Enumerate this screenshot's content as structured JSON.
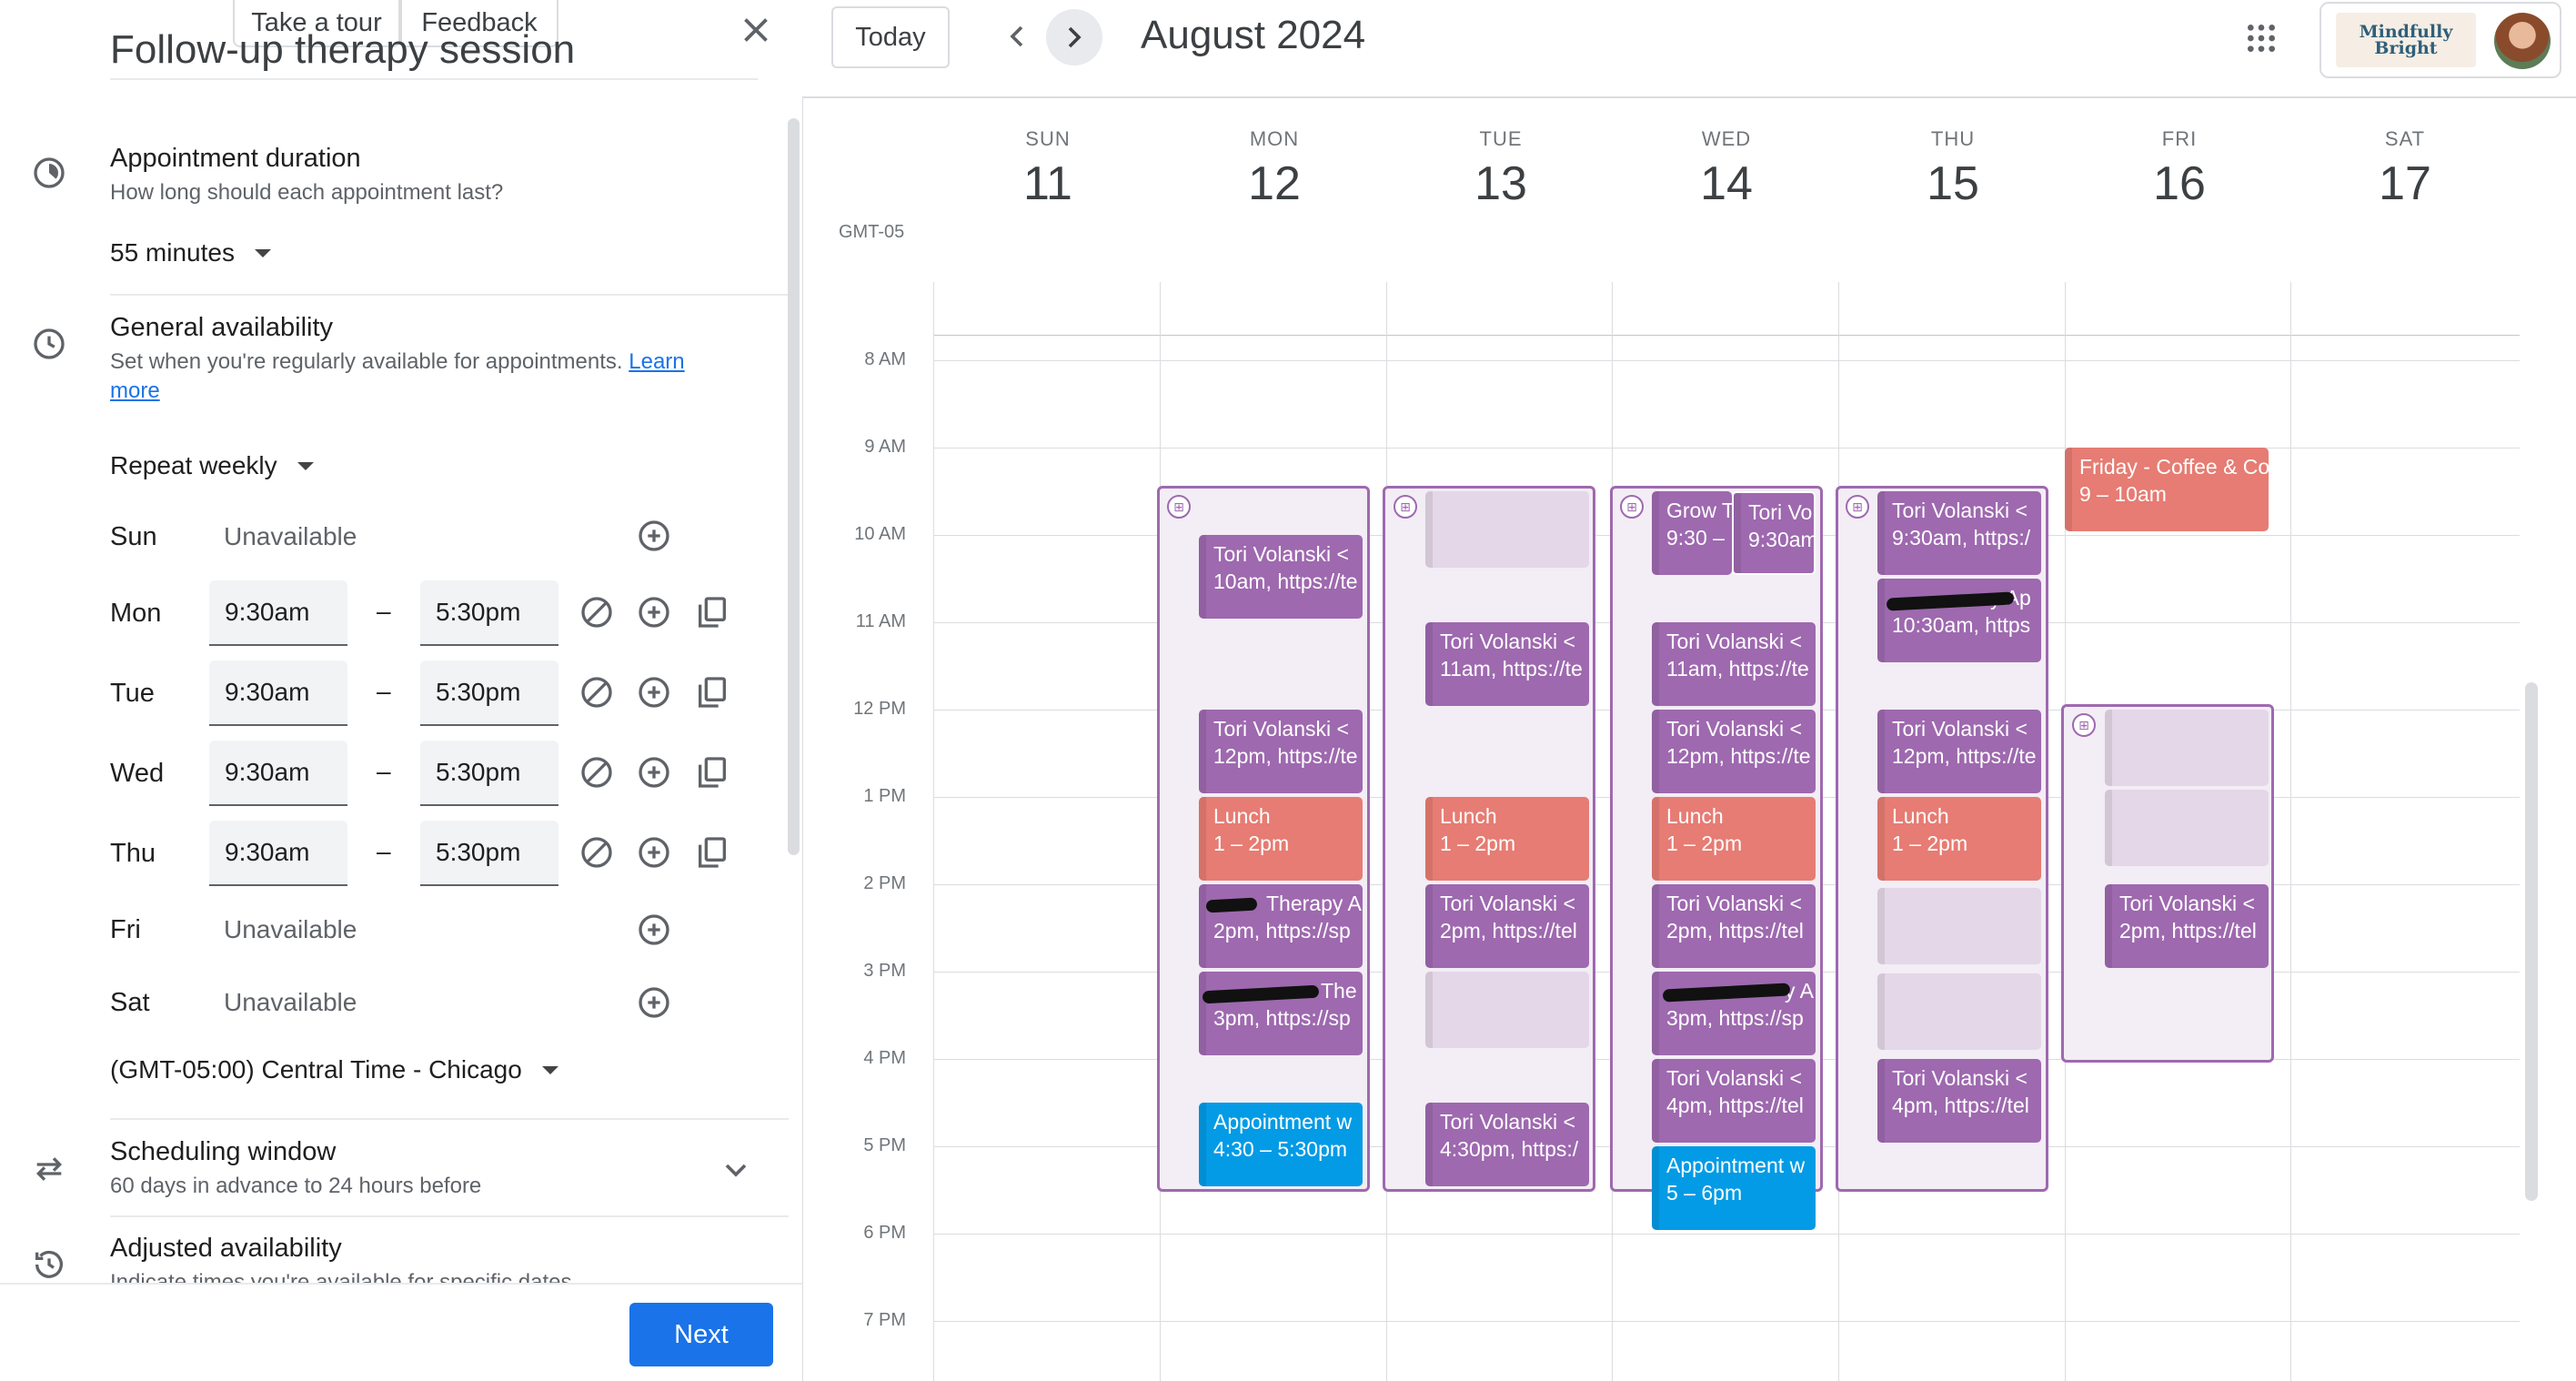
{
  "panel": {
    "tour_label": "Take a tour",
    "feedback_label": "Feedback",
    "title_partial": "Follow-up therapy session",
    "duration": {
      "title": "Appointment duration",
      "subtitle": "How long should each appointment last?",
      "value": "55 minutes"
    },
    "availability": {
      "title": "General availability",
      "subtitle": "Set when you're regularly available for appointments.",
      "learn_more": "Learn",
      "learn_more2": "more",
      "repeat": "Repeat weekly"
    },
    "days": [
      {
        "day": "Sun",
        "unavailable": "Unavailable"
      },
      {
        "day": "Mon",
        "start": "9:30am",
        "sep": "–",
        "end": "5:30pm"
      },
      {
        "day": "Tue",
        "start": "9:30am",
        "sep": "–",
        "end": "5:30pm"
      },
      {
        "day": "Wed",
        "start": "9:30am",
        "sep": "–",
        "end": "5:30pm"
      },
      {
        "day": "Thu",
        "start": "9:30am",
        "sep": "–",
        "end": "5:30pm"
      },
      {
        "day": "Fri",
        "unavailable": "Unavailable"
      },
      {
        "day": "Sat",
        "unavailable": "Unavailable"
      }
    ],
    "timezone": "(GMT-05:00) Central Time - Chicago",
    "scheduling": {
      "title": "Scheduling window",
      "subtitle": "60 days in advance to 24 hours before"
    },
    "adjusted": {
      "title": "Adjusted availability",
      "subtitle": "Indicate times you're available for specific dates"
    },
    "next_label": "Next"
  },
  "calendar": {
    "today_label": "Today",
    "title": "August 2024",
    "tz": "GMT-05",
    "days": [
      {
        "dow": "SUN",
        "num": "11"
      },
      {
        "dow": "MON",
        "num": "12"
      },
      {
        "dow": "TUE",
        "num": "13"
      },
      {
        "dow": "WED",
        "num": "14"
      },
      {
        "dow": "THU",
        "num": "15"
      },
      {
        "dow": "FRI",
        "num": "16"
      },
      {
        "dow": "SAT",
        "num": "17"
      }
    ],
    "hours": [
      "8 AM",
      "9 AM",
      "10 AM",
      "11 AM",
      "12 PM",
      "1 PM",
      "2 PM",
      "3 PM",
      "4 PM",
      "5 PM",
      "6 PM",
      "7 PM"
    ],
    "brand_text": "Mindfully Bright",
    "events": {
      "mon_1a": "Tori Volanski <",
      "mon_1b": "10am, https://te",
      "mon_2a": "Tori Volanski <",
      "mon_2b": "12pm, https://te",
      "mon_3a": "Lunch",
      "mon_3b": "1 – 2pm",
      "mon_4a": "Therapy A",
      "mon_4b": "2pm, https://sp",
      "mon_5a": "The",
      "mon_5b": "3pm, https://sp",
      "mon_6a": "Appointment w",
      "mon_6b": "4:30 – 5:30pm",
      "tue_1a": "Tori Volanski <",
      "tue_1b": "11am, https://te",
      "tue_2a": "Lunch",
      "tue_2b": "1 – 2pm",
      "tue_3a": "Tori Volanski <",
      "tue_3b": "2pm, https://tel",
      "tue_4a": "Tori Volanski <",
      "tue_4b": "4:30pm, https:/",
      "wed_1a": "Grow T",
      "wed_1b": "9:30 –",
      "wed_2a": "Tori Vo",
      "wed_2b": "9:30am",
      "wed_3a": "Tori Volanski <",
      "wed_3b": "11am, https://te",
      "wed_4a": "Tori Volanski <",
      "wed_4b": "12pm, https://te",
      "wed_5a": "Lunch",
      "wed_5b": "1 – 2pm",
      "wed_6a": "Tori Volanski <",
      "wed_6b": "2pm, https://tel",
      "wed_7a": "y A",
      "wed_7b": "3pm, https://sp",
      "wed_8a": "Tori Volanski <",
      "wed_8b": "4pm, https://tel",
      "wed_9a": "Appointment w",
      "wed_9b": "5 – 6pm",
      "thu_1a": "Tori Volanski <",
      "thu_1b": "9:30am, https:/",
      "thu_2a": "y Ap",
      "thu_2b": "10:30am, https",
      "thu_3a": "Tori Volanski <",
      "thu_3b": "12pm, https://te",
      "thu_4a": "Lunch",
      "thu_4b": "1 – 2pm",
      "thu_5a": "Tori Volanski <",
      "thu_5b": "4pm, https://tel",
      "fri_1a": "Friday - Coffee & Co",
      "fri_1b": "9 – 10am",
      "fri_2a": "Tori Volanski <",
      "fri_2b": "2pm, https://tel"
    }
  }
}
